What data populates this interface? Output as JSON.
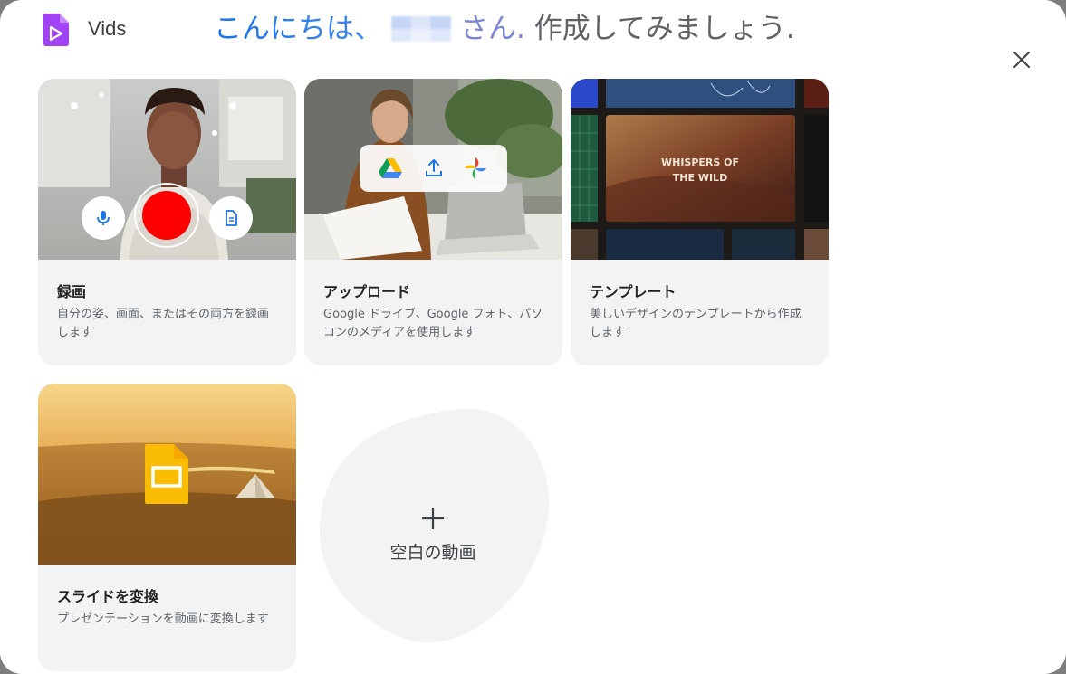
{
  "app": {
    "name": "Vids"
  },
  "greeting": {
    "hello": "こんにちは、",
    "san": "さん.",
    "rest": "作成してみましょう."
  },
  "cards": [
    {
      "title": "録画",
      "description": "自分の姿、画面、またはその両方を録画します"
    },
    {
      "title": "アップロード",
      "description": "Google ドライブ、Google フォト、パソコンのメディアを使用します"
    },
    {
      "title": "テンプレート",
      "description": "美しいデザインのテンプレートから作成します",
      "thumbnail_text": [
        "WHISPERS OF",
        "THE WILD"
      ]
    },
    {
      "title": "スライドを変換",
      "description": "プレゼンテーションを動画に変換します"
    }
  ],
  "blank": {
    "label": "空白の動画"
  },
  "colors": {
    "accent": "#1a73e8",
    "record": "#ff0000",
    "card_bg": "#f1f3f4",
    "brand": "#a142f4"
  },
  "icons": [
    "vids-logo-icon",
    "close-icon",
    "mic-icon",
    "record-icon",
    "transcript-icon",
    "drive-icon",
    "upload-icon",
    "photos-icon",
    "slides-icon",
    "plus-icon"
  ]
}
